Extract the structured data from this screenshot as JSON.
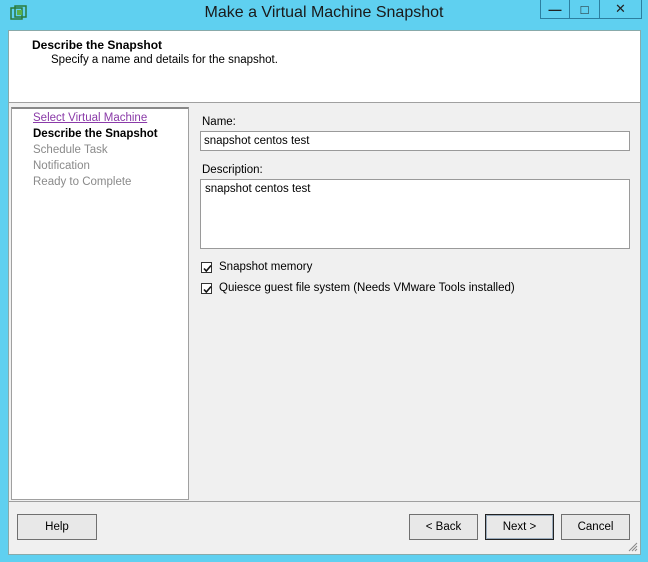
{
  "window": {
    "title": "Make a Virtual Machine Snapshot",
    "minimize_glyph": "—",
    "maximize_glyph": "□",
    "close_glyph": "✕",
    "icon": "vsphere-app-icon"
  },
  "header": {
    "title": "Describe the Snapshot",
    "subtitle": "Specify a name and details for the snapshot."
  },
  "steps": [
    {
      "label": "Select Virtual Machine",
      "state": "link"
    },
    {
      "label": "Describe the Snapshot",
      "state": "active"
    },
    {
      "label": "Schedule Task",
      "state": "disabled"
    },
    {
      "label": "Notification",
      "state": "disabled"
    },
    {
      "label": "Ready to Complete",
      "state": "disabled"
    }
  ],
  "form": {
    "name_label": "Name:",
    "name_value": "snapshot centos test",
    "description_label": "Description:",
    "description_value": "snapshot centos test",
    "snapshot_memory_label": "Snapshot memory",
    "snapshot_memory_checked": true,
    "quiesce_label": "Quiesce guest file system (Needs VMware Tools installed)",
    "quiesce_checked": true
  },
  "buttons": {
    "help": "Help",
    "back": "< Back",
    "next": "Next >",
    "cancel": "Cancel"
  },
  "colors": {
    "window_frame": "#5fd0f0",
    "link": "#8a3aa8",
    "disabled_text": "#8a8a8a"
  }
}
